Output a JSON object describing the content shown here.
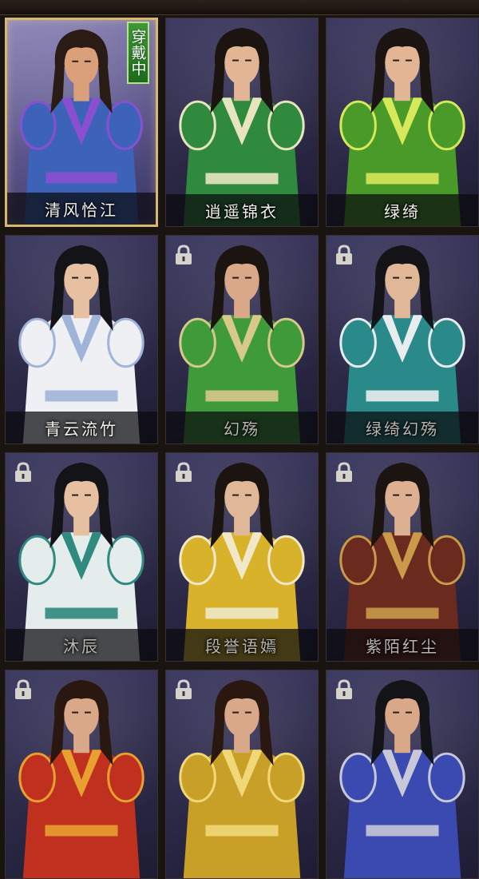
{
  "costumes": [
    {
      "name": "清风恰江",
      "selected": true,
      "locked": false,
      "badge": "穿戴中",
      "robe": "#3c63b8",
      "trim": "#8a4fd0",
      "skin": "#d9a07a",
      "hair": "#2a1c14"
    },
    {
      "name": "逍遥锦衣",
      "selected": false,
      "locked": false,
      "badge": "",
      "robe": "#2f8a3e",
      "trim": "#e8e4c0",
      "skin": "#e2b694",
      "hair": "#1c1410"
    },
    {
      "name": "绿绮",
      "selected": false,
      "locked": false,
      "badge": "",
      "robe": "#4a9a2a",
      "trim": "#d7e85a",
      "skin": "#e2b694",
      "hair": "#1c1410"
    },
    {
      "name": "青云流竹",
      "selected": false,
      "locked": false,
      "badge": "",
      "robe": "#eef0f4",
      "trim": "#9fb4d8",
      "skin": "#e6c0a0",
      "hair": "#141418"
    },
    {
      "name": "幻殇",
      "selected": false,
      "locked": true,
      "badge": "",
      "robe": "#3f9a3a",
      "trim": "#d8c88a",
      "skin": "#d9a888",
      "hair": "#1c1410"
    },
    {
      "name": "绿绮幻殇",
      "selected": false,
      "locked": true,
      "badge": "",
      "robe": "#2a8a8a",
      "trim": "#e8ecee",
      "skin": "#e0b898",
      "hair": "#141418"
    },
    {
      "name": "沐辰",
      "selected": false,
      "locked": true,
      "badge": "",
      "robe": "#e4ecec",
      "trim": "#2f8a80",
      "skin": "#e6c0a0",
      "hair": "#141418"
    },
    {
      "name": "段誉语嫣",
      "selected": false,
      "locked": true,
      "badge": "",
      "robe": "#d8b22a",
      "trim": "#f0e8c8",
      "skin": "#e0b898",
      "hair": "#1c1410"
    },
    {
      "name": "紫陌红尘",
      "selected": false,
      "locked": true,
      "badge": "",
      "robe": "#6a2a1e",
      "trim": "#c89a4a",
      "skin": "#dcb090",
      "hair": "#1c1410"
    },
    {
      "name": "",
      "selected": false,
      "locked": true,
      "badge": "",
      "robe": "#c0301e",
      "trim": "#e8a030",
      "skin": "#d9a888",
      "hair": "#2a1810"
    },
    {
      "name": "",
      "selected": false,
      "locked": true,
      "badge": "",
      "robe": "#c8a028",
      "trim": "#f0d878",
      "skin": "#d9a888",
      "hair": "#2a1810"
    },
    {
      "name": "",
      "selected": false,
      "locked": true,
      "badge": "",
      "robe": "#3a4ab0",
      "trim": "#c8c8d8",
      "skin": "#d9a888",
      "hair": "#141418"
    }
  ]
}
